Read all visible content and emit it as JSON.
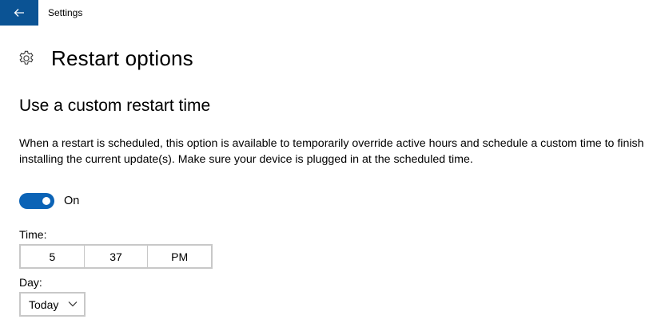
{
  "window": {
    "title": "Settings"
  },
  "header": {
    "title": "Restart options"
  },
  "section": {
    "title": "Use a custom restart time",
    "description": "When a restart is scheduled, this option is available to temporarily override active hours and schedule a custom time to finish installing the current update(s). Make sure your device is plugged in at the scheduled time."
  },
  "toggle": {
    "label": "On",
    "state": true
  },
  "time": {
    "label": "Time:",
    "hour": "5",
    "minute": "37",
    "period": "PM"
  },
  "day": {
    "label": "Day:",
    "value": "Today"
  },
  "colors": {
    "accent": "#0b63b6",
    "back_button": "#0b5394",
    "border": "#c8c8c8"
  },
  "icons": {
    "back": "back-arrow-icon",
    "settings": "gear-icon",
    "dropdown": "chevron-down-icon"
  }
}
